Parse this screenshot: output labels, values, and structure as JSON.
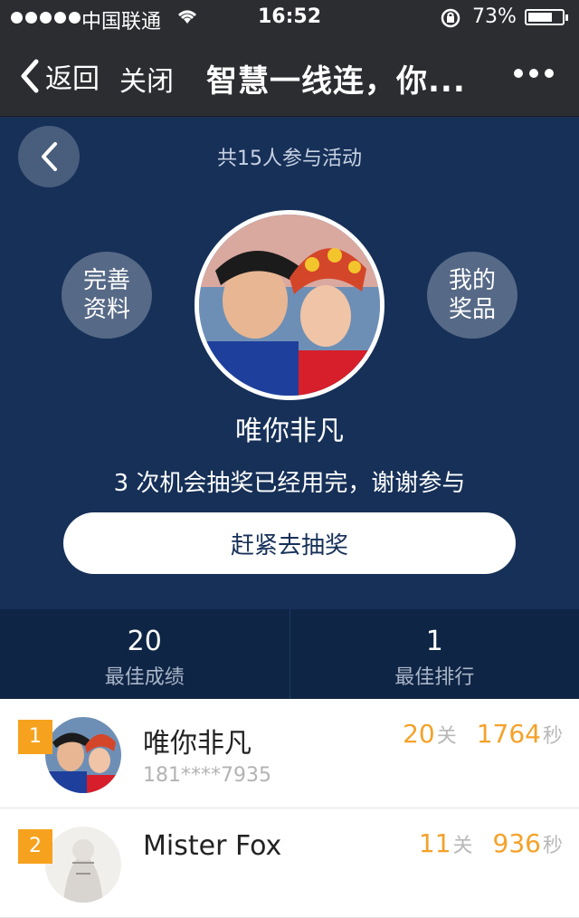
{
  "status_bar": {
    "carrier": "中国联通",
    "time": "16:52",
    "battery": "73%",
    "battery_level": 0.73
  },
  "nav": {
    "back_label": "返回",
    "close_label": "关闭",
    "title": "智慧一线连，你..."
  },
  "profile": {
    "participants": "共15人参与活动",
    "complete_profile": [
      "完善",
      "资料"
    ],
    "my_prizes": [
      "我的",
      "奖品"
    ],
    "username": "唯你非凡",
    "chances_text": "3 次机会抽奖已经用完，谢谢参与",
    "lottery_button": "赶紧去抽奖"
  },
  "stats": {
    "best_score_value": "20",
    "best_score_label": "最佳成绩",
    "best_rank_value": "1",
    "best_rank_label": "最佳排行"
  },
  "leaderboard": [
    {
      "rank": "1",
      "name": "唯你非凡",
      "phone": "181****7935",
      "levels": "20",
      "level_unit": "关",
      "seconds": "1764",
      "second_unit": "秒"
    },
    {
      "rank": "2",
      "name": "Mister Fox",
      "phone": "",
      "levels": "11",
      "level_unit": "关",
      "seconds": "936",
      "second_unit": "秒"
    }
  ],
  "colors": {
    "status_bg": "#2b2d31",
    "profile_bg": "#163058",
    "stats_bg": "#0f2545",
    "accent_orange": "#f6a21e"
  }
}
